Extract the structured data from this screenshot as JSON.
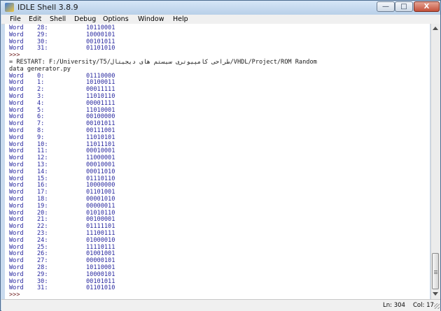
{
  "window": {
    "title": "IDLE Shell 3.8.9",
    "minimize_glyph": "—",
    "maximize_glyph": "□",
    "close_glyph": "X"
  },
  "menu": [
    "File",
    "Edit",
    "Shell",
    "Debug",
    "Options",
    "Window",
    "Help"
  ],
  "shell": {
    "top_rows": [
      {
        "word": "Word",
        "idx": "28:",
        "val": "10110001"
      },
      {
        "word": "Word",
        "idx": "29:",
        "val": "10000101"
      },
      {
        "word": "Word",
        "idx": "30:",
        "val": "00101011"
      },
      {
        "word": "Word",
        "idx": "31:",
        "val": "01101010"
      }
    ],
    "prompt_1": ">>>",
    "restart_line_1": "= RESTART: F:/University/T5/طراحی کامپیوتری سیستم های دیجیتال/VHDL/Project/ROM Random",
    "restart_line_2": "data generator.py",
    "rows": [
      {
        "word": "Word",
        "idx": "0:",
        "val": "01110000"
      },
      {
        "word": "Word",
        "idx": "1:",
        "val": "10100011"
      },
      {
        "word": "Word",
        "idx": "2:",
        "val": "00011111"
      },
      {
        "word": "Word",
        "idx": "3:",
        "val": "11010110"
      },
      {
        "word": "Word",
        "idx": "4:",
        "val": "00001111"
      },
      {
        "word": "Word",
        "idx": "5:",
        "val": "11010001"
      },
      {
        "word": "Word",
        "idx": "6:",
        "val": "00100000"
      },
      {
        "word": "Word",
        "idx": "7:",
        "val": "00101011"
      },
      {
        "word": "Word",
        "idx": "8:",
        "val": "00111001"
      },
      {
        "word": "Word",
        "idx": "9:",
        "val": "11010101"
      },
      {
        "word": "Word",
        "idx": "10:",
        "val": "11011101"
      },
      {
        "word": "Word",
        "idx": "11:",
        "val": "00010001"
      },
      {
        "word": "Word",
        "idx": "12:",
        "val": "11000001"
      },
      {
        "word": "Word",
        "idx": "13:",
        "val": "00010001"
      },
      {
        "word": "Word",
        "idx": "14:",
        "val": "00011010"
      },
      {
        "word": "Word",
        "idx": "15:",
        "val": "01110110"
      },
      {
        "word": "Word",
        "idx": "16:",
        "val": "10000000"
      },
      {
        "word": "Word",
        "idx": "17:",
        "val": "01101001"
      },
      {
        "word": "Word",
        "idx": "18:",
        "val": "00001010"
      },
      {
        "word": "Word",
        "idx": "19:",
        "val": "00000011"
      },
      {
        "word": "Word",
        "idx": "20:",
        "val": "01010110"
      },
      {
        "word": "Word",
        "idx": "21:",
        "val": "00100001"
      },
      {
        "word": "Word",
        "idx": "22:",
        "val": "01111101"
      },
      {
        "word": "Word",
        "idx": "23:",
        "val": "11100111"
      },
      {
        "word": "Word",
        "idx": "24:",
        "val": "01000010"
      },
      {
        "word": "Word",
        "idx": "25:",
        "val": "11110111"
      },
      {
        "word": "Word",
        "idx": "26:",
        "val": "01001001"
      },
      {
        "word": "Word",
        "idx": "27:",
        "val": "00000101"
      },
      {
        "word": "Word",
        "idx": "28:",
        "val": "10110001"
      },
      {
        "word": "Word",
        "idx": "29:",
        "val": "10000101"
      },
      {
        "word": "Word",
        "idx": "30:",
        "val": "00101011"
      },
      {
        "word": "Word",
        "idx": "31:",
        "val": "01101010"
      }
    ],
    "prompt_2": ">>>"
  },
  "status": {
    "ln": "Ln: 304",
    "col": "Col: 17"
  }
}
